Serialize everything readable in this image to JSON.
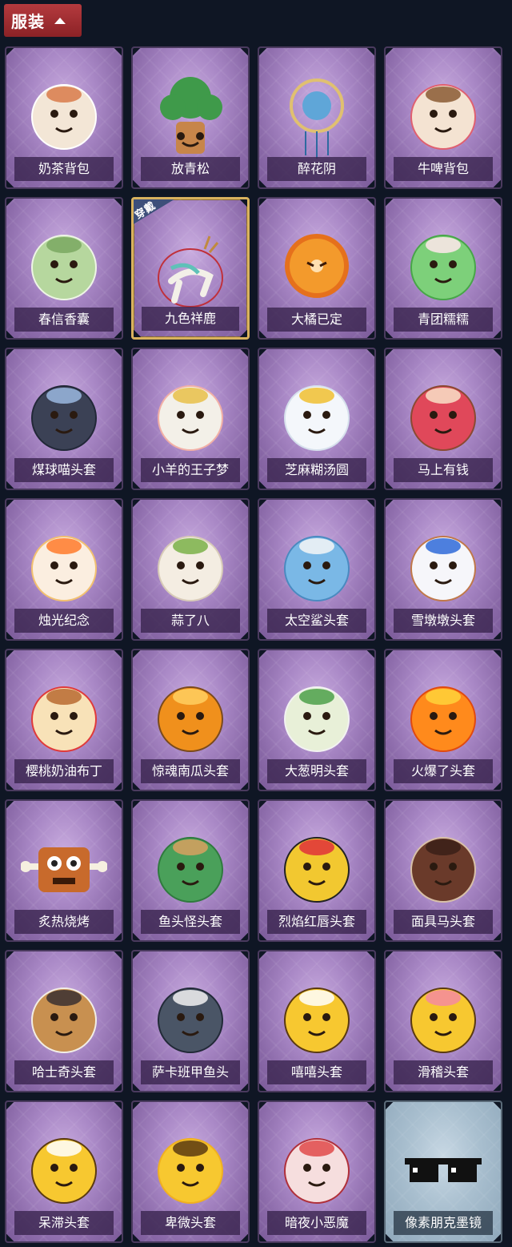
{
  "header": {
    "title": "服装"
  },
  "items": [
    {
      "name": "奶茶背包",
      "art": "milk-tea-backpack",
      "colors": [
        "#f3e6d6",
        "#d87a4a",
        "#ffffff"
      ]
    },
    {
      "name": "放青松",
      "art": "pine-tree-pot",
      "colors": [
        "#3f9a4a",
        "#c7854a",
        "#6a3e20"
      ]
    },
    {
      "name": "醉花阴",
      "art": "flower-ornament",
      "colors": [
        "#5fa6d8",
        "#e0c070",
        "#2e6aa0"
      ]
    },
    {
      "name": "牛啤背包",
      "art": "cow-beer-mug",
      "colors": [
        "#f4e3d2",
        "#8a5a34",
        "#e06070"
      ]
    },
    {
      "name": "春信香囊",
      "art": "sachet",
      "colors": [
        "#b6d79e",
        "#7aa860",
        "#eef5e6"
      ]
    },
    {
      "name": "九色祥鹿",
      "art": "nine-color-deer",
      "colors": [
        "#f3f0e8",
        "#5fc1b8",
        "#c08a3e"
      ],
      "worn": true,
      "badge": "穿戴"
    },
    {
      "name": "大橘已定",
      "art": "orange-slice",
      "colors": [
        "#f39a2c",
        "#ffe0b0",
        "#e5701c"
      ]
    },
    {
      "name": "青团糯糯",
      "art": "green-rice-ball",
      "colors": [
        "#7dd07a",
        "#ffe8ec",
        "#47a648"
      ]
    },
    {
      "name": "煤球喵头套",
      "art": "black-cat-head",
      "colors": [
        "#3b4155",
        "#9bb8e0",
        "#222838"
      ]
    },
    {
      "name": "小羊的王子梦",
      "art": "sheep-prince",
      "colors": [
        "#f3f0e8",
        "#e8c048",
        "#f2b0a6"
      ]
    },
    {
      "name": "芝麻糊汤圆",
      "art": "rice-dumpling",
      "colors": [
        "#f4f7fb",
        "#f0c030",
        "#d6e0ec"
      ]
    },
    {
      "name": "马上有钱",
      "art": "red-horse",
      "colors": [
        "#e0485a",
        "#f8e2c8",
        "#8a4a32"
      ]
    },
    {
      "name": "烛光纪念",
      "art": "candle",
      "colors": [
        "#fbeee0",
        "#ff7a2a",
        "#f2c070"
      ]
    },
    {
      "name": "蒜了八",
      "art": "garlic",
      "colors": [
        "#f4ede2",
        "#7ab048",
        "#d8cbb8"
      ]
    },
    {
      "name": "太空鲨头套",
      "art": "shark-head",
      "colors": [
        "#7ab8e6",
        "#f6f6f6",
        "#4a8ac0"
      ]
    },
    {
      "name": "雪墩墩头套",
      "art": "snowman-head",
      "colors": [
        "#f6f6fa",
        "#2f6ad8",
        "#c0784a"
      ]
    },
    {
      "name": "樱桃奶油布丁",
      "art": "pudding",
      "colors": [
        "#f8e2b8",
        "#b86a30",
        "#e03a3a"
      ]
    },
    {
      "name": "惊魂南瓜头套",
      "art": "pumpkin-head",
      "colors": [
        "#f0901c",
        "#ffd060",
        "#7a4a1c"
      ]
    },
    {
      "name": "大葱明头套",
      "art": "green-onion-head",
      "colors": [
        "#e8f0d8",
        "#4ca04a",
        "#f2f2f2"
      ]
    },
    {
      "name": "火爆了头套",
      "art": "fire-head",
      "colors": [
        "#ff8a1c",
        "#ffd23a",
        "#e04a10"
      ]
    },
    {
      "name": "炙热烧烤",
      "art": "bbq-meat",
      "colors": [
        "#c86a2c",
        "#f6efe0",
        "#8a3a14"
      ]
    },
    {
      "name": "鱼头怪头套",
      "art": "fish-head",
      "colors": [
        "#4aa05a",
        "#d8a060",
        "#2f7a3e"
      ]
    },
    {
      "name": "烈焰红唇头套",
      "art": "yellow-mouse-head",
      "colors": [
        "#f2c830",
        "#e0303a",
        "#222222"
      ]
    },
    {
      "name": "面具马头套",
      "art": "horse-mask",
      "colors": [
        "#6a3a2a",
        "#3a2018",
        "#d8c0a8"
      ]
    },
    {
      "name": "哈士奇头套",
      "art": "husky-head",
      "colors": [
        "#c89050",
        "#3a3030",
        "#f2eee6"
      ]
    },
    {
      "name": "萨卡班甲鱼头",
      "art": "sacabambaspis-head",
      "colors": [
        "#4a5566",
        "#f2f2f2",
        "#222a38"
      ]
    },
    {
      "name": "嘻嘻头套",
      "art": "grin-emoji",
      "colors": [
        "#f7c830",
        "#ffffff",
        "#5a3a10"
      ]
    },
    {
      "name": "滑稽头套",
      "art": "funny-emoji",
      "colors": [
        "#f7c830",
        "#f48aa0",
        "#5a3a10"
      ]
    },
    {
      "name": "呆滞头套",
      "art": "stare-emoji",
      "colors": [
        "#f7c830",
        "#ffffff",
        "#5a3a10"
      ]
    },
    {
      "name": "卑微头套",
      "art": "humble-emoji",
      "colors": [
        "#f7c830",
        "#5a3a10",
        "#f0b020"
      ]
    },
    {
      "name": "暗夜小恶魔",
      "art": "little-devil",
      "colors": [
        "#f6dede",
        "#e04a4a",
        "#b0303a"
      ]
    },
    {
      "name": "像素朋克墨镜",
      "art": "pixel-sunglasses",
      "colors": [
        "#111111",
        "#ffffff",
        "#555555"
      ],
      "variant": "blue"
    }
  ]
}
